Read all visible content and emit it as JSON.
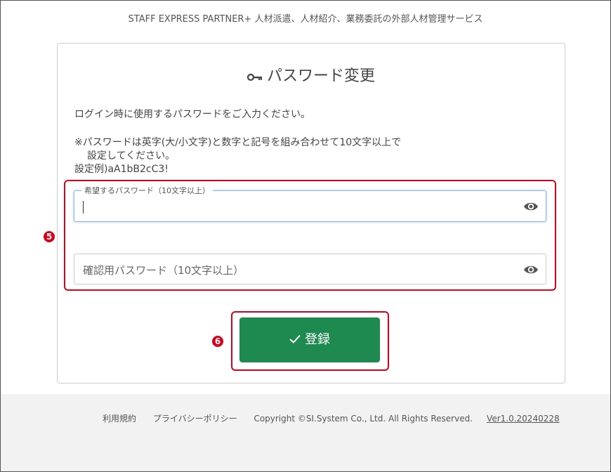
{
  "header": {
    "tagline": "STAFF EXPRESS PARTNER+ 人材派遣、人材紹介、業務委託の外部人材管理サービス"
  },
  "card": {
    "title": "パスワード変更",
    "title_icon": "key-icon",
    "intro": "ログイン時に使用するパスワードをご入力ください。",
    "note_line1": "※パスワードは英字(大/小文字)と数字と記号を組み合わせて10文字以上で",
    "note_line2": "設定してください。",
    "note_example": "設定例)aA1bB2cC3!"
  },
  "form": {
    "password_label": "希望するパスワード（10文字以上）",
    "password_value": "",
    "confirm_placeholder": "確認用パスワード（10文字以上）",
    "confirm_value": "",
    "toggle_icon": "eye-icon",
    "submit_label": "登録",
    "submit_icon": "check-icon"
  },
  "annotations": {
    "fields_marker": "5",
    "submit_marker": "6",
    "color": "#d9001b"
  },
  "footer": {
    "terms": "利用規約",
    "privacy": "プライバシーポリシー",
    "copyright": "Copyright ©SI.System Co., Ltd. All Rights Reserved.",
    "version": "Ver1.0.20240228"
  },
  "colors": {
    "submit": "#1e8a4f",
    "focus_border": "#8fb4e8",
    "footer_bg": "#f2f2f2"
  }
}
